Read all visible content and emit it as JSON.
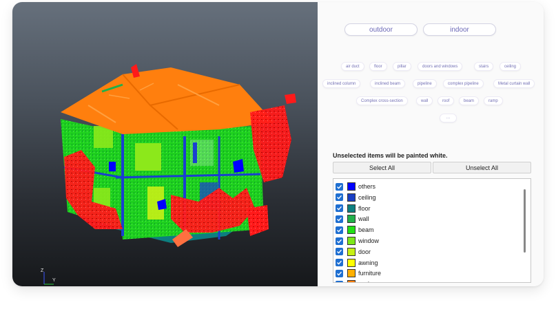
{
  "scene_buttons": [
    "outdoor",
    "indoor"
  ],
  "category_chips": [
    [
      "air duct",
      "floor",
      "pillar",
      "doors and windows",
      "stairs",
      "ceiling"
    ],
    [
      "inclined column",
      "inclined beam",
      "pipeline",
      "complex pipeline",
      "Metal curtain wall"
    ],
    [
      "Complex cross-section",
      "wall",
      "roof",
      "beam",
      "ramp"
    ],
    [
      "···"
    ]
  ],
  "hint": "Unselected items will be painted white.",
  "select_all_label": "Select All",
  "unselect_all_label": "Unselect All",
  "class_items": [
    {
      "label": "others",
      "color": "#0000ff",
      "checked": true
    },
    {
      "label": "ceiling",
      "color": "#1a3fc4",
      "checked": true
    },
    {
      "label": "floor",
      "color": "#0e8080",
      "checked": true
    },
    {
      "label": "wall",
      "color": "#21b04a",
      "checked": true
    },
    {
      "label": "beam",
      "color": "#22e016",
      "checked": true
    },
    {
      "label": "window",
      "color": "#7de81b",
      "checked": true
    },
    {
      "label": "door",
      "color": "#c6f016",
      "checked": true
    },
    {
      "label": "awning",
      "color": "#ffff00",
      "checked": true
    },
    {
      "label": "furniture",
      "color": "#ffb000",
      "checked": true
    },
    {
      "label": "roof",
      "color": "#ff7f00",
      "checked": true
    }
  ],
  "axes": {
    "z": "Z",
    "y": "Y"
  },
  "colors": {
    "accent": "#1f6fd1",
    "chip_text": "#7370b5",
    "roof": "#ff7f0e",
    "wall": "#21b04a",
    "clutter": "#ff1a1a"
  }
}
